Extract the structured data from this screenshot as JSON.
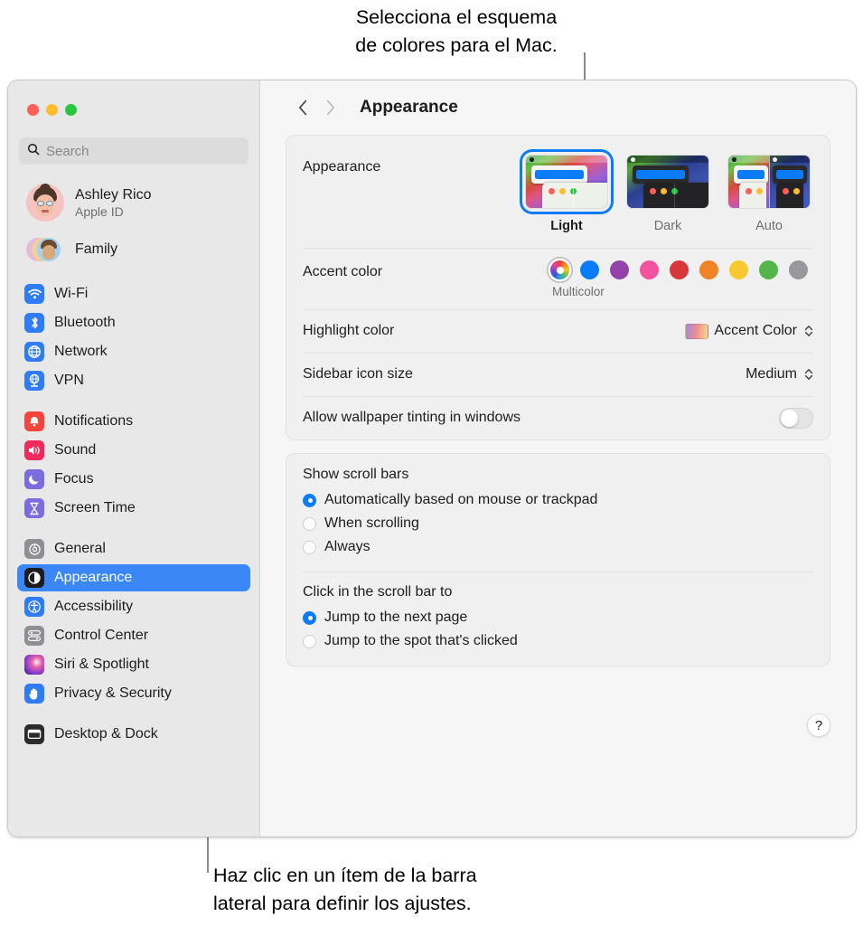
{
  "callouts": {
    "top": "Selecciona el esquema\nde colores para el Mac.",
    "bottom": "Haz clic en un ítem de la barra\nlateral para definir los ajustes."
  },
  "window": {
    "title": "Appearance"
  },
  "sidebar": {
    "search": {
      "placeholder": "Search",
      "value": ""
    },
    "account": {
      "name": "Ashley Rico",
      "subtitle": "Apple ID"
    },
    "family": {
      "label": "Family"
    },
    "groups": [
      {
        "items": [
          {
            "label": "Wi-Fi",
            "icon": "wifi-icon",
            "color": "#2f7cf6"
          },
          {
            "label": "Bluetooth",
            "icon": "bluetooth-icon",
            "color": "#2f7cf6"
          },
          {
            "label": "Network",
            "icon": "globe-icon",
            "color": "#2f7cf6"
          },
          {
            "label": "VPN",
            "icon": "vpn-icon",
            "color": "#2f7cf6"
          }
        ]
      },
      {
        "items": [
          {
            "label": "Notifications",
            "icon": "bell-icon",
            "color": "#f4453c"
          },
          {
            "label": "Sound",
            "icon": "speaker-icon",
            "color": "#f2295b"
          },
          {
            "label": "Focus",
            "icon": "moon-icon",
            "color": "#7b6ce0"
          },
          {
            "label": "Screen Time",
            "icon": "hourglass-icon",
            "color": "#7b6ce0"
          }
        ]
      },
      {
        "items": [
          {
            "label": "General",
            "icon": "gear-icon",
            "color": "#8e8e93"
          },
          {
            "label": "Appearance",
            "icon": "appearance-icon",
            "color": "#1d1d1f",
            "selected": true
          },
          {
            "label": "Accessibility",
            "icon": "accessibility-icon",
            "color": "#2f7cf6"
          },
          {
            "label": "Control Center",
            "icon": "control-center-icon",
            "color": "#8e8e93"
          },
          {
            "label": "Siri & Spotlight",
            "icon": "siri-icon",
            "color": "#c0397f"
          },
          {
            "label": "Privacy & Security",
            "icon": "hand-icon",
            "color": "#2f7cf6"
          }
        ]
      },
      {
        "items": [
          {
            "label": "Desktop & Dock",
            "icon": "desktop-icon",
            "color": "#2b2b2e"
          }
        ]
      }
    ]
  },
  "main": {
    "appearance": {
      "label": "Appearance",
      "options": [
        {
          "label": "Light",
          "selected": true
        },
        {
          "label": "Dark",
          "selected": false
        },
        {
          "label": "Auto",
          "selected": false
        }
      ]
    },
    "accent": {
      "label": "Accent color",
      "caption": "Multicolor",
      "swatches": [
        {
          "name": "Multicolor",
          "color": "multicolor",
          "selected": true
        },
        {
          "name": "Blue",
          "color": "#0a7cf9",
          "selected": false
        },
        {
          "name": "Purple",
          "color": "#9242a8",
          "selected": false
        },
        {
          "name": "Pink",
          "color": "#f2529e",
          "selected": false
        },
        {
          "name": "Red",
          "color": "#d8363a",
          "selected": false
        },
        {
          "name": "Orange",
          "color": "#ef8326",
          "selected": false
        },
        {
          "name": "Yellow",
          "color": "#f7c92e",
          "selected": false
        },
        {
          "name": "Green",
          "color": "#54b54b",
          "selected": false
        },
        {
          "name": "Graphite",
          "color": "#98989d",
          "selected": false
        }
      ]
    },
    "highlight": {
      "label": "Highlight color",
      "value": "Accent Color"
    },
    "sidebar_icon_size": {
      "label": "Sidebar icon size",
      "value": "Medium"
    },
    "wallpaper_tinting": {
      "label": "Allow wallpaper tinting in windows",
      "on": false
    },
    "scroll_bars": {
      "title": "Show scroll bars",
      "options": [
        {
          "label": "Automatically based on mouse or trackpad",
          "selected": true
        },
        {
          "label": "When scrolling",
          "selected": false
        },
        {
          "label": "Always",
          "selected": false
        }
      ]
    },
    "scroll_click": {
      "title": "Click in the scroll bar to",
      "options": [
        {
          "label": "Jump to the next page",
          "selected": true
        },
        {
          "label": "Jump to the spot that's clicked",
          "selected": false
        }
      ]
    },
    "help_label": "?"
  }
}
